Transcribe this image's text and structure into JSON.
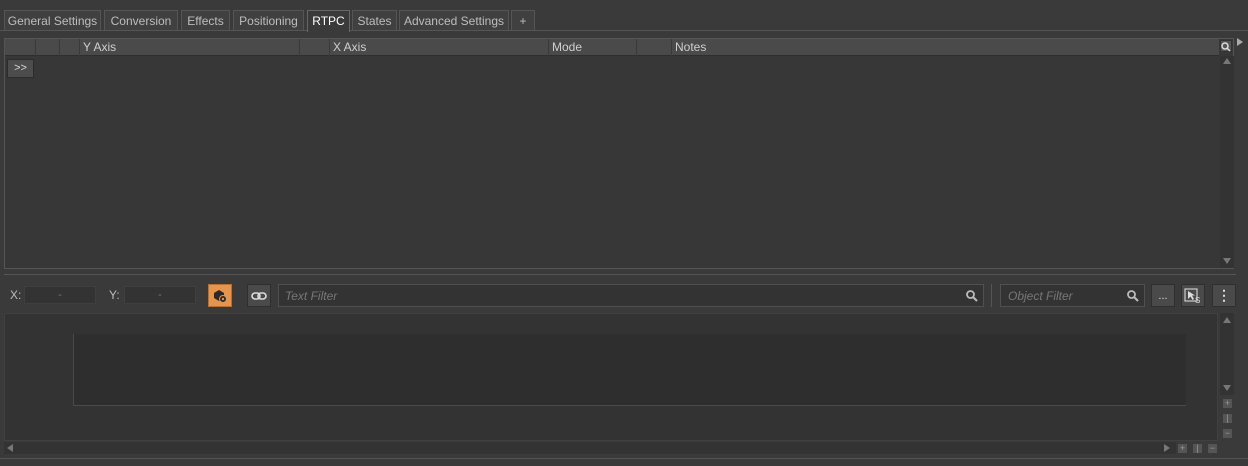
{
  "tabs": [
    {
      "label": "General Settings",
      "active": false
    },
    {
      "label": "Conversion",
      "active": false
    },
    {
      "label": "Effects",
      "active": false
    },
    {
      "label": "Positioning",
      "active": false
    },
    {
      "label": "RTPC",
      "active": true
    },
    {
      "label": "States",
      "active": false
    },
    {
      "label": "Advanced Settings",
      "active": false
    },
    {
      "label": "+",
      "active": false
    }
  ],
  "grid": {
    "columns": [
      "",
      "",
      "",
      "Y Axis",
      "",
      "X Axis",
      "Mode",
      "",
      "Notes"
    ],
    "expand_label": ">>"
  },
  "toolbar": {
    "x_label": "X:",
    "x_value": "-",
    "y_label": "Y:",
    "y_value": "-",
    "text_filter_placeholder": "Text Filter",
    "object_filter_placeholder": "Object Filter",
    "more_label": "...",
    "menu_label": "⋮"
  },
  "icons": {
    "orange_button": "cube-tag-icon",
    "link": "link-icon",
    "search": "search-icon",
    "select_state": "cursor-s-icon"
  },
  "colors": {
    "accent": "#e7954a",
    "background": "#3a3a3a"
  }
}
